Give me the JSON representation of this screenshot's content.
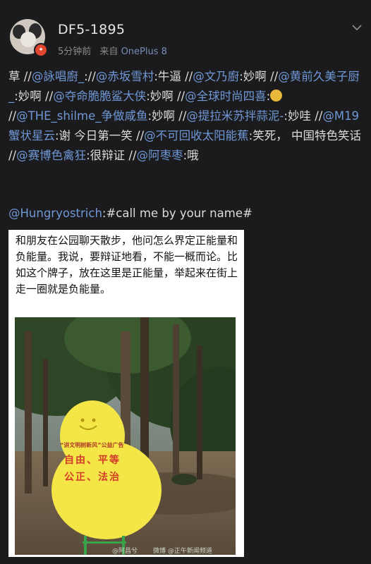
{
  "post": {
    "username": "DF5-1895",
    "time": "5分钟前",
    "source_prefix": "来自",
    "source": "OnePlus 8"
  },
  "comment": {
    "segments": [
      {
        "t": "草 //"
      },
      {
        "t": "@詠唱廚_",
        "m": true
      },
      {
        "t": "://"
      },
      {
        "t": "@赤坂雪村",
        "m": true
      },
      {
        "t": ":牛逼 //"
      },
      {
        "t": "@文乃廚",
        "m": true
      },
      {
        "t": ":妙啊 //"
      },
      {
        "t": "@黄前久美子厨_",
        "m": true
      },
      {
        "t": ":妙啊 //"
      },
      {
        "t": "@夺命脆脆鲨大侠",
        "m": true
      },
      {
        "t": ":妙啊 //"
      },
      {
        "t": "@全球时尚四喜",
        "m": true
      },
      {
        "t": ":"
      },
      {
        "e": true
      },
      {
        "t": "//"
      },
      {
        "t": "@THE_shilme_争做咸鱼",
        "m": true
      },
      {
        "t": ":妙啊 //"
      },
      {
        "t": "@提拉米苏拌蒜泥-",
        "m": true
      },
      {
        "t": ":妙哇 //"
      },
      {
        "t": "@M19蟹状星云",
        "m": true
      },
      {
        "t": ":谢 今日第一笑 //"
      },
      {
        "t": "@不可回收太阳能蕉",
        "m": true
      },
      {
        "t": ":笑死， 中国特色笑话 //"
      },
      {
        "t": "@赛博色禽狂",
        "m": true
      },
      {
        "t": ":很辩证 //"
      },
      {
        "t": "@阿枣枣",
        "m": true
      },
      {
        "t": ":哦"
      }
    ],
    "emoji": "doge-emoji"
  },
  "repost": {
    "author": "@Hungryostrich",
    "tag": ":#call me by your name#"
  },
  "card": {
    "text": "和朋友在公园聊天散步，他问怎么界定正能量和负能量。我说，要辩证地看，不能一概而论。比如这个牌子，放在这里是正能量，举起来在街上走一圈就是负能量。",
    "sign_header": "“讲文明树新风”公益广告",
    "sign_line1": "自由、平等",
    "sign_line2": "公正、法治",
    "watermark1": "@阿昌兮",
    "watermark2": "微博 @正午新闻频道",
    "colors": {
      "sign": "#f3e646",
      "sign_text": "#d23a2a",
      "mention": "#6f97d6"
    }
  }
}
